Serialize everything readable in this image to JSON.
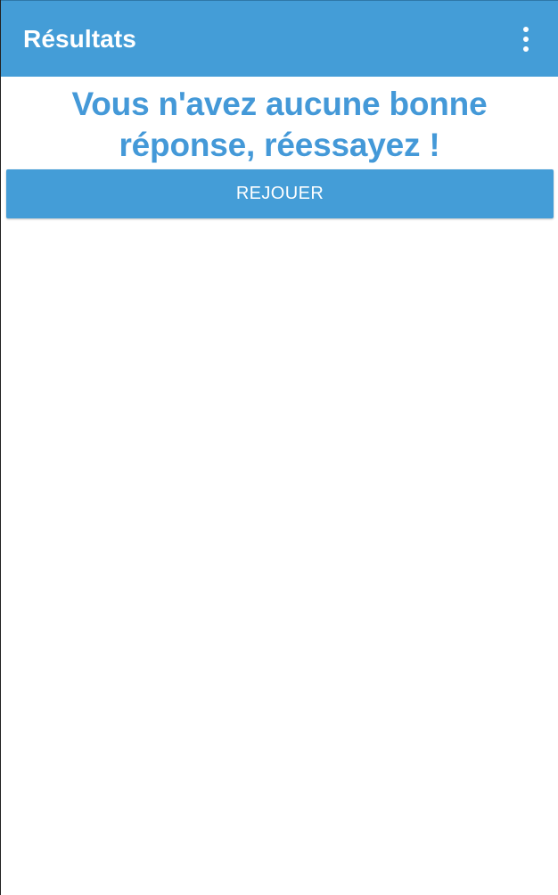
{
  "app_bar": {
    "title": "Résultats",
    "overflow_icon": "more-vert-icon",
    "background_color": "#449dd7"
  },
  "main": {
    "message": "Vous n'avez aucune bonne réponse, réessayez !",
    "message_color": "#4499d8",
    "replay_button_label": "REJOUER"
  }
}
